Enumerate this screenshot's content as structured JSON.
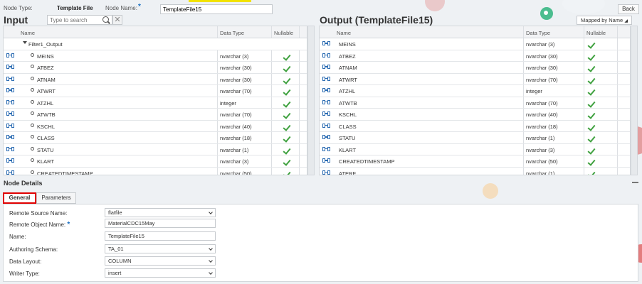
{
  "header": {
    "node_type_label": "Node Type:",
    "node_type_value": "Template File",
    "node_name_label": "Node Name:",
    "required_mark": "*",
    "node_name_value": "TemplateFile15",
    "back_label": "Back"
  },
  "input_panel": {
    "title": "Input",
    "search_placeholder": "Type to search",
    "clear_glyph": "✕",
    "columns": [
      "Name",
      "Data Type",
      "Nullable"
    ],
    "group_name": "Filter1_Output",
    "rows": [
      {
        "name": "MEINS",
        "type": "nvarchar (3)"
      },
      {
        "name": "ATBEZ",
        "type": "nvarchar (30)"
      },
      {
        "name": "ATNAM",
        "type": "nvarchar (30)"
      },
      {
        "name": "ATWRT",
        "type": "nvarchar (70)"
      },
      {
        "name": "ATZHL",
        "type": "integer"
      },
      {
        "name": "ATWTB",
        "type": "nvarchar (70)"
      },
      {
        "name": "KSCHL",
        "type": "nvarchar (40)"
      },
      {
        "name": "CLASS",
        "type": "nvarchar (18)"
      },
      {
        "name": "STATU",
        "type": "nvarchar (1)"
      },
      {
        "name": "KLART",
        "type": "nvarchar (3)"
      },
      {
        "name": "CREATEDTIMESTAMP",
        "type": "nvarchar (50)"
      }
    ]
  },
  "output_panel": {
    "title": "Output (TemplateFile15)",
    "mapped_label": "Mapped by Name",
    "columns": [
      "Name",
      "Data Type",
      "Nullable"
    ],
    "rows": [
      {
        "name": "MEINS",
        "type": "nvarchar (3)"
      },
      {
        "name": "ATBEZ",
        "type": "nvarchar (30)"
      },
      {
        "name": "ATNAM",
        "type": "nvarchar (30)"
      },
      {
        "name": "ATWRT",
        "type": "nvarchar (70)"
      },
      {
        "name": "ATZHL",
        "type": "integer"
      },
      {
        "name": "ATWTB",
        "type": "nvarchar (70)"
      },
      {
        "name": "KSCHL",
        "type": "nvarchar (40)"
      },
      {
        "name": "CLASS",
        "type": "nvarchar (18)"
      },
      {
        "name": "STATU",
        "type": "nvarchar (1)"
      },
      {
        "name": "KLART",
        "type": "nvarchar (3)"
      },
      {
        "name": "CREATEDTIMESTAMP",
        "type": "nvarchar (50)"
      },
      {
        "name": "ATERF",
        "type": "nvarchar (1)"
      }
    ]
  },
  "node_details": {
    "title": "Node Details",
    "tabs": [
      "General",
      "Parameters"
    ],
    "active_tab": "General",
    "fields": [
      {
        "label": "Remote Source Name:",
        "value": "flatfile",
        "dropdown": true,
        "required": false
      },
      {
        "label": "Remote Object Name:",
        "value": "MaterialCDC15May",
        "dropdown": false,
        "required": true
      },
      {
        "label": "Name:",
        "value": "TemplateFile15",
        "dropdown": false,
        "required": false
      },
      {
        "label": "Authoring Schema:",
        "value": "TA_01",
        "dropdown": true,
        "required": false
      },
      {
        "label": "Data Layout:",
        "value": "COLUMN",
        "dropdown": true,
        "required": false
      },
      {
        "label": "Writer Type:",
        "value": "insert",
        "dropdown": true,
        "required": false
      }
    ]
  },
  "colors": {
    "accent": "#1a6fc2",
    "check": "#3fa13f",
    "active_tab_border": "#e00000",
    "link_icon": "#2d6db3"
  }
}
